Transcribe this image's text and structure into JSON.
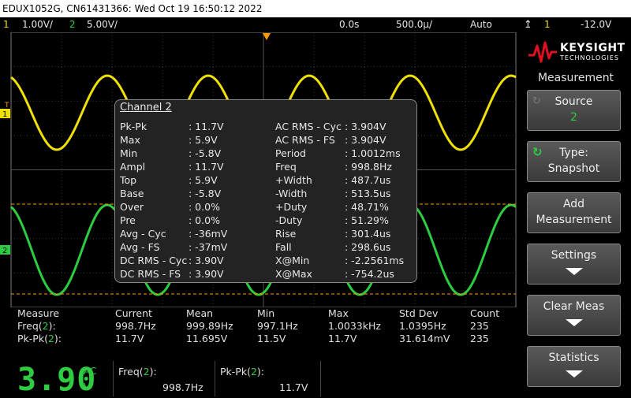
{
  "titlebar": {
    "text": "EDUX1052G, CN61431366: Wed Oct 19 16:50:12 2022"
  },
  "topbar": {
    "ch1_num": "1",
    "ch1_scale": "1.00V/",
    "ch2_num": "2",
    "ch2_scale": "5.00V/",
    "delay": "0.0s",
    "timebase": "500.0µ/",
    "trigger_mode": "Auto",
    "trig_source": "1",
    "trig_level": "-12.0V",
    "trig_icon": "edge-trigger-icon"
  },
  "colors": {
    "ch1": "#f0e000",
    "ch2": "#2ecc40",
    "accent_orange": "#ff9900"
  },
  "markers": {
    "ch1": "1",
    "ch2": "2",
    "trigger": "T"
  },
  "popup": {
    "title": "Channel 2",
    "left": [
      {
        "label": "Pk-Pk",
        "value": ": 11.7V"
      },
      {
        "label": "Max",
        "value": ": 5.9V"
      },
      {
        "label": "Min",
        "value": ": -5.8V"
      },
      {
        "label": "Ampl",
        "value": ": 11.7V"
      },
      {
        "label": "Top",
        "value": ": 5.9V"
      },
      {
        "label": "Base",
        "value": ": -5.8V"
      },
      {
        "label": "Over",
        "value": ": 0.0%"
      },
      {
        "label": "Pre",
        "value": ": 0.0%"
      },
      {
        "label": "Avg - Cyc",
        "value": ": -36mV"
      },
      {
        "label": "Avg - FS",
        "value": ": -37mV"
      },
      {
        "label": "DC RMS - Cyc",
        "value": ": 3.90V"
      },
      {
        "label": "DC RMS - FS",
        "value": ": 3.90V"
      }
    ],
    "right": [
      {
        "label": "AC RMS - Cyc",
        "value": ": 3.904V"
      },
      {
        "label": "AC RMS - FS",
        "value": ": 3.904V"
      },
      {
        "label": "Period",
        "value": ": 1.0012ms"
      },
      {
        "label": "Freq",
        "value": ": 998.8Hz"
      },
      {
        "label": "+Width",
        "value": ": 487.7us"
      },
      {
        "label": "-Width",
        "value": ": 513.5us"
      },
      {
        "label": "+Duty",
        "value": ": 48.71%"
      },
      {
        "label": "-Duty",
        "value": ": 51.29%"
      },
      {
        "label": "Rise",
        "value": ": 301.4us"
      },
      {
        "label": "Fall",
        "value": ": 298.6us"
      },
      {
        "label": "X@Min",
        "value": ": -2.2561ms"
      },
      {
        "label": "X@Max",
        "value": ": -754.2us"
      }
    ]
  },
  "meas_table": {
    "headers": [
      "Measure",
      "Current",
      "Mean",
      "Min",
      "Max",
      "Std Dev",
      "Count"
    ],
    "rows": [
      {
        "name": "Freq",
        "src": "2",
        "suffix": "):",
        "cells": [
          "998.7Hz",
          "999.89Hz",
          "997.1Hz",
          "1.0033kHz",
          "1.0395Hz",
          "235"
        ]
      },
      {
        "name": "Pk-Pk",
        "src": "2",
        "suffix": "):",
        "cells": [
          "11.7V",
          "11.695V",
          "11.5V",
          "11.7V",
          "31.614mV",
          "235"
        ]
      }
    ]
  },
  "bottom": {
    "big_value": "3.90",
    "big_ac": "AC",
    "big_unit": "V",
    "m1_name": "Freq(",
    "m1_src": "2",
    "m1_end": "):",
    "m1_value": "998.7Hz",
    "m2_name": "Pk-Pk(",
    "m2_src": "2",
    "m2_end": "):",
    "m2_value": "11.7V"
  },
  "panel": {
    "logo_top": "KEYSIGHT",
    "logo_bottom": "TECHNOLOGIES",
    "logo_icon": "keysight-wave-logo",
    "menu_title": "Measurement",
    "source_label": "Source",
    "source_value": "2",
    "type_label": "Type:",
    "type_value": "Snapshot",
    "add_l1": "Add",
    "add_l2": "Measurement",
    "settings_label": "Settings",
    "clear_label": "Clear Meas",
    "stats_label": "Statistics"
  }
}
